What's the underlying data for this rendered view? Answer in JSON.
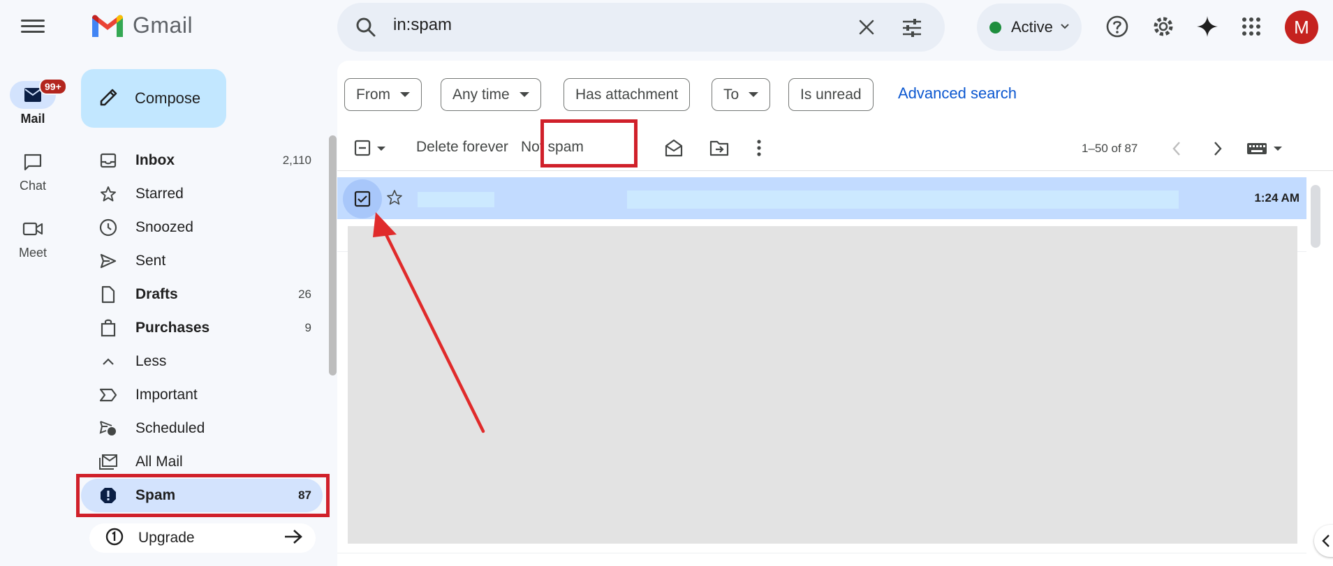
{
  "rail": {
    "items": [
      {
        "label": "Mail",
        "badge": "99+"
      },
      {
        "label": "Chat"
      },
      {
        "label": "Meet"
      }
    ]
  },
  "header": {
    "logo_text": "Gmail",
    "search_value": "in:spam",
    "status": "Active",
    "avatar_letter": "M"
  },
  "sidebar": {
    "compose_label": "Compose",
    "items": [
      {
        "label": "Inbox",
        "count": "2,110"
      },
      {
        "label": "Starred",
        "count": ""
      },
      {
        "label": "Snoozed",
        "count": ""
      },
      {
        "label": "Sent",
        "count": ""
      },
      {
        "label": "Drafts",
        "count": "26"
      },
      {
        "label": "Purchases",
        "count": "9"
      },
      {
        "label": "Less",
        "count": ""
      },
      {
        "label": "Important",
        "count": ""
      },
      {
        "label": "Scheduled",
        "count": ""
      },
      {
        "label": "All Mail",
        "count": ""
      },
      {
        "label": "Spam",
        "count": "87"
      }
    ],
    "upgrade_label": "Upgrade"
  },
  "filters": {
    "chips": [
      "From",
      "Any time",
      "Has attachment",
      "To",
      "Is unread"
    ],
    "advanced_search": "Advanced search"
  },
  "toolbar": {
    "delete_forever": "Delete forever",
    "not_spam": "Not spam",
    "pager": "1–50 of 87"
  },
  "messages": [
    {
      "time": "1:24 AM",
      "selected": true
    }
  ],
  "colors": {
    "accent": "#0b57d0",
    "highlight": "#d0202a",
    "selected_row": "#c2dbff",
    "compose": "#c2e7ff"
  }
}
